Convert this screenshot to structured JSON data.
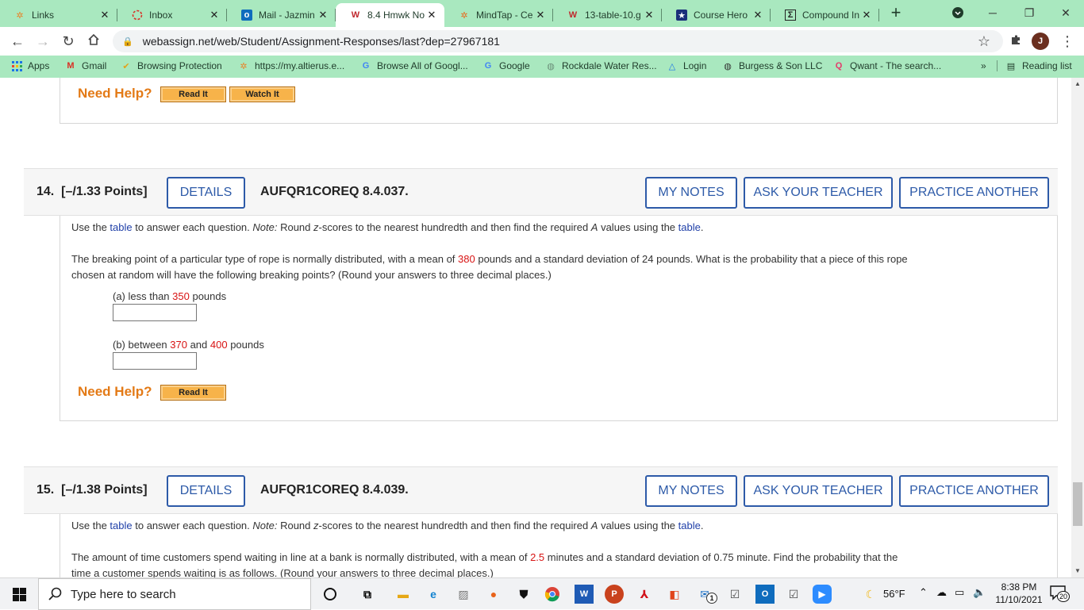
{
  "browser": {
    "tabs": [
      {
        "label": "Links",
        "icon": "altierus-icon",
        "active": false
      },
      {
        "label": "Inbox",
        "icon": "gmail-loading-icon",
        "active": false
      },
      {
        "label": "Mail - Jazmin",
        "icon": "outlook-icon",
        "active": false
      },
      {
        "label": "8.4 Hmwk No",
        "icon": "webassign-icon",
        "active": true
      },
      {
        "label": "MindTap - Ce",
        "icon": "mindtap-icon",
        "active": false
      },
      {
        "label": "13-table-10.g",
        "icon": "webassign-icon",
        "active": false
      },
      {
        "label": "Course Hero",
        "icon": "course-hero-icon",
        "active": false
      },
      {
        "label": "Compound In",
        "icon": "sigma-icon",
        "active": false
      }
    ],
    "new_tab_symbol": "+",
    "url": "webassign.net/web/Student/Assignment-Responses/last?dep=27967181",
    "profile_initial": "J",
    "bookmarks": [
      {
        "label": "Apps",
        "icon": "apps-grid-icon"
      },
      {
        "label": "Gmail",
        "icon": "gmail-icon"
      },
      {
        "label": "Browsing Protection",
        "icon": "checkmark-icon"
      },
      {
        "label": "https://my.altierus.e...",
        "icon": "altierus-icon"
      },
      {
        "label": "Browse All of Googl...",
        "icon": "google-icon"
      },
      {
        "label": "Google",
        "icon": "google-icon"
      },
      {
        "label": "Rockdale Water Res...",
        "icon": "globe-icon"
      },
      {
        "label": "Login",
        "icon": "triangle-logo-icon"
      },
      {
        "label": "Burgess & Son LLC",
        "icon": "globe-icon"
      },
      {
        "label": "Qwant - The search...",
        "icon": "qwant-icon"
      }
    ],
    "bookmarks_overflow": "»",
    "reading_list": "Reading list"
  },
  "page": {
    "prev_question": {
      "need_help": "Need Help?",
      "read_it": "Read It",
      "watch_it": "Watch It"
    },
    "q14": {
      "number": "14.",
      "points": "[–/1.33 Points]",
      "details": "DETAILS",
      "code": "AUFQR1COREQ 8.4.037.",
      "my_notes": "MY NOTES",
      "ask_teacher": "ASK YOUR TEACHER",
      "practice": "PRACTICE ANOTHER",
      "instr": {
        "p1": "Use the ",
        "link1": "table",
        "p2": " to answer each question. ",
        "note": "Note:",
        "p3": " Round ",
        "z": "z",
        "p4": "-scores to the nearest hundredth and then find the required ",
        "a": "A",
        "p5": " values using the ",
        "link2": "table",
        "p6": "."
      },
      "stem": {
        "s1": "The breaking point of a particular type of rope is normally distributed, with a mean of ",
        "mean": "380",
        "s2": " pounds and a standard deviation of 24 pounds. What is the probability that a piece of this rope",
        "s3": "chosen at random will have the following breaking points? (Round your answers to three decimal places.)"
      },
      "part_a": {
        "s1": "(a) less than ",
        "v1": "350",
        "s2": " pounds",
        "value": ""
      },
      "part_b": {
        "s1": "(b) between ",
        "v1": "370",
        "s2": " and ",
        "v2": "400",
        "s3": " pounds",
        "value": ""
      },
      "need_help": "Need Help?",
      "read_it": "Read It"
    },
    "q15": {
      "number": "15.",
      "points": "[–/1.38 Points]",
      "details": "DETAILS",
      "code": "AUFQR1COREQ 8.4.039.",
      "my_notes": "MY NOTES",
      "ask_teacher": "ASK YOUR TEACHER",
      "practice": "PRACTICE ANOTHER",
      "instr": {
        "p1": "Use the ",
        "link1": "table",
        "p2": " to answer each question. ",
        "note": "Note:",
        "p3": " Round ",
        "z": "z",
        "p4": "-scores to the nearest hundredth and then find the required ",
        "a": "A",
        "p5": " values using the ",
        "link2": "table",
        "p6": "."
      },
      "stem": {
        "s1": "The amount of time customers spend waiting in line at a bank is normally distributed, with a mean of ",
        "mean": "2.5",
        "s2": " minutes and a standard deviation of 0.75 minute. Find the probability that the",
        "s3": "time a customer spends waiting is as follows. (Round your answers to three decimal places.)"
      }
    }
  },
  "taskbar": {
    "search_placeholder": "Type here to search",
    "weather": "56°F",
    "time": "8:38 PM",
    "date": "11/10/2021",
    "notification_count": "20",
    "outlook_badge": "1"
  },
  "colors": {
    "chrome_green": "#a9e8bf",
    "accent_blue": "#2d5aa8",
    "help_orange": "#e37a16",
    "value_red": "#d81414"
  }
}
